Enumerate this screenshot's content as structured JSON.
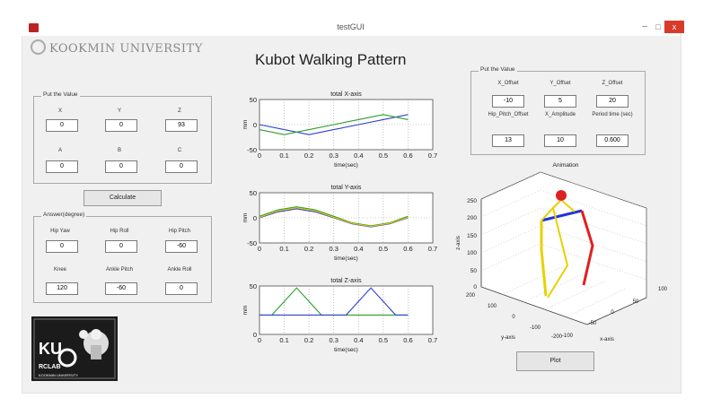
{
  "window": {
    "title": "testGUI",
    "min": "–",
    "max": "□",
    "close": "x"
  },
  "logo": "KOOKMIN UNIVERSITY",
  "main_title": "Kubot Walking Pattern",
  "input_panel": {
    "legend": "Put the Value",
    "labels": [
      "X",
      "Y",
      "Z",
      "A",
      "B",
      "C"
    ],
    "values": [
      "0",
      "0",
      "93",
      "0",
      "0",
      "0"
    ]
  },
  "calculate_label": "Calculate",
  "answer_panel": {
    "legend": "Answer(degree)",
    "labels": [
      "Hip Yaw",
      "Hip Roll",
      "Hip Pitch",
      "Knee",
      "Ankle Pitch",
      "Ankle Roll"
    ],
    "values": [
      "0",
      "0",
      "-60",
      "120",
      "-60",
      "0"
    ]
  },
  "offset_panel": {
    "legend": "Put the Value",
    "labels": [
      "X_Offset",
      "Y_Offset",
      "Z_Offset",
      "Hip_Pitch_Offset",
      "X_Amplitude",
      "Period time (sec)"
    ],
    "values": [
      "-10",
      "5",
      "20",
      "13",
      "10",
      "0.600"
    ]
  },
  "plot_label": "Plot",
  "kubo_logo": {
    "text": "KU",
    "sub": "RCLAB",
    "bottom": "KOOKMIN UNIVERSITY"
  },
  "chart_data": [
    {
      "type": "line",
      "title": "total X-axis",
      "xlabel": "time(sec)",
      "ylabel": "mm",
      "xlim": [
        0,
        0.7
      ],
      "ylim": [
        -50,
        50
      ],
      "grid": true,
      "x_ticks": [
        "0",
        "0.1",
        "0.2",
        "0.3",
        "0.4",
        "0.5",
        "0.6",
        "0.7"
      ],
      "y_ticks": [
        "50",
        "0",
        "-50"
      ],
      "x": [
        0,
        0.1,
        0.2,
        0.3,
        0.4,
        0.5,
        0.6
      ],
      "series": [
        {
          "color": "#2f3fd0",
          "values": [
            0,
            -10,
            -20,
            -10,
            0,
            10,
            20
          ]
        },
        {
          "color": "#2aa02a",
          "values": [
            -10,
            -20,
            -10,
            0,
            10,
            20,
            10
          ]
        }
      ]
    },
    {
      "type": "line",
      "title": "total Y-axis",
      "xlabel": "time(sec)",
      "ylabel": "mm",
      "xlim": [
        0,
        0.7
      ],
      "ylim": [
        -50,
        50
      ],
      "grid": true,
      "x_ticks": [
        "0",
        "0.1",
        "0.2",
        "0.3",
        "0.4",
        "0.5",
        "0.6",
        "0.7"
      ],
      "y_ticks": [
        "50",
        "0",
        "-50"
      ],
      "x": [
        0,
        0.075,
        0.15,
        0.225,
        0.3,
        0.375,
        0.45,
        0.525,
        0.6
      ],
      "series": [
        {
          "color": "#2f3fd0",
          "values": [
            0,
            12,
            18,
            12,
            0,
            -12,
            -18,
            -12,
            0
          ]
        },
        {
          "color": "#2aa02a",
          "values": [
            3,
            16,
            22,
            16,
            3,
            -10,
            -16,
            -10,
            3
          ]
        },
        {
          "color": "#e8c300",
          "values": [
            1,
            14,
            20,
            14,
            1,
            -11,
            -17,
            -11,
            1
          ]
        }
      ]
    },
    {
      "type": "line",
      "title": "total Z-axis",
      "xlabel": "time(sec)",
      "ylabel": "mm",
      "xlim": [
        0,
        0.7
      ],
      "ylim": [
        0,
        50
      ],
      "grid": true,
      "x_ticks": [
        "0",
        "0.1",
        "0.2",
        "0.3",
        "0.4",
        "0.5",
        "0.6",
        "0.7"
      ],
      "y_ticks": [
        "50",
        "0"
      ],
      "x": [
        0,
        0.05,
        0.1,
        0.15,
        0.2,
        0.25,
        0.3,
        0.35,
        0.4,
        0.45,
        0.5,
        0.55,
        0.6
      ],
      "series": [
        {
          "color": "#2aa02a",
          "values": [
            20,
            20,
            34,
            48,
            34,
            20,
            20,
            20,
            20,
            20,
            20,
            20,
            20
          ]
        },
        {
          "color": "#2f3fd0",
          "values": [
            20,
            20,
            20,
            20,
            20,
            20,
            20,
            20,
            34,
            48,
            34,
            20,
            20
          ]
        }
      ]
    }
  ],
  "animation_3d": {
    "title": "Animation",
    "z_label": "z-axis",
    "y_label": "y-axis",
    "x_label": "x-axis",
    "z_ticks": [
      "250",
      "200",
      "150",
      "100",
      "50",
      "0"
    ],
    "y_ticks": [
      "200",
      "100",
      "0",
      "-100",
      "-200"
    ],
    "x_ticks": [
      "-100",
      "-50",
      "0",
      "50",
      "100"
    ]
  }
}
